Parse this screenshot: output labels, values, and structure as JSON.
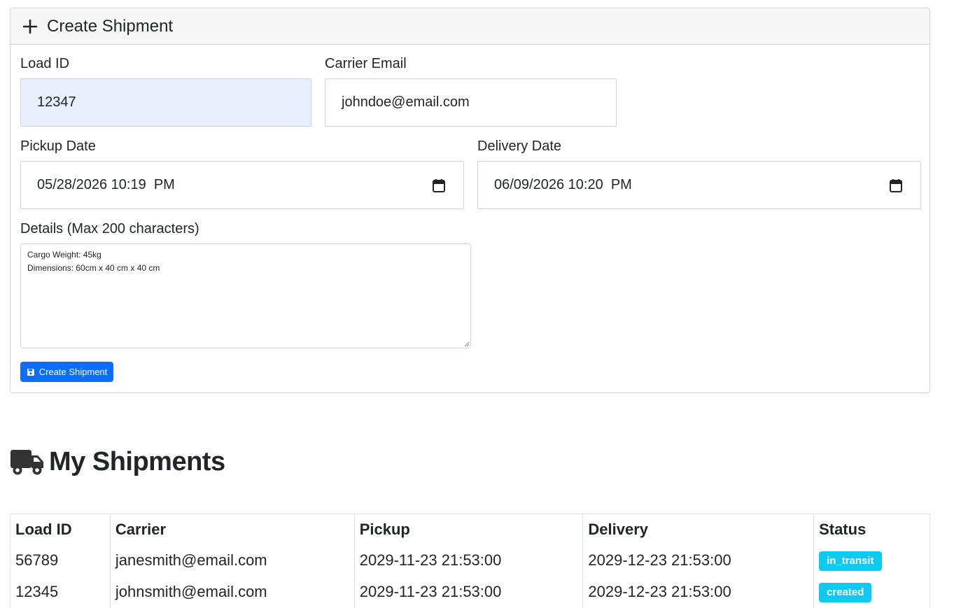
{
  "create_card": {
    "title": "Create Shipment",
    "load_id": {
      "label": "Load ID",
      "value": "12347"
    },
    "carrier_email": {
      "label": "Carrier Email",
      "value": "johndoe@email.com"
    },
    "pickup_date": {
      "label": "Pickup Date",
      "value": "05/28/2026 10:19  PM"
    },
    "delivery_date": {
      "label": "Delivery Date",
      "value": "06/09/2026 10:20  PM"
    },
    "details": {
      "label": "Details (Max 200 characters)",
      "value": "Cargo Weight: 45kg\nDimensions: 60cm x 40 cm x 40 cm"
    },
    "submit_label": "Create Shipment"
  },
  "shipments_section": {
    "title": "My Shipments",
    "columns": [
      "Load ID",
      "Carrier",
      "Pickup",
      "Delivery",
      "Status"
    ],
    "rows": [
      {
        "load_id": "56789",
        "carrier": "janesmith@email.com",
        "pickup": "2029-11-23 21:53:00",
        "delivery": "2029-12-23 21:53:00",
        "status": "in_transit"
      },
      {
        "load_id": "12345",
        "carrier": "johnsmith@email.com",
        "pickup": "2029-11-23 21:53:00",
        "delivery": "2029-12-23 21:53:00",
        "status": "created"
      }
    ]
  },
  "colors": {
    "primary": "#0d6efd",
    "badge": "#0dcaf0",
    "autofill": "#e8f0fe"
  },
  "icons": {
    "header": "plus-icon",
    "date": "calendar-icon",
    "submit": "save-icon",
    "section": "truck-icon"
  }
}
